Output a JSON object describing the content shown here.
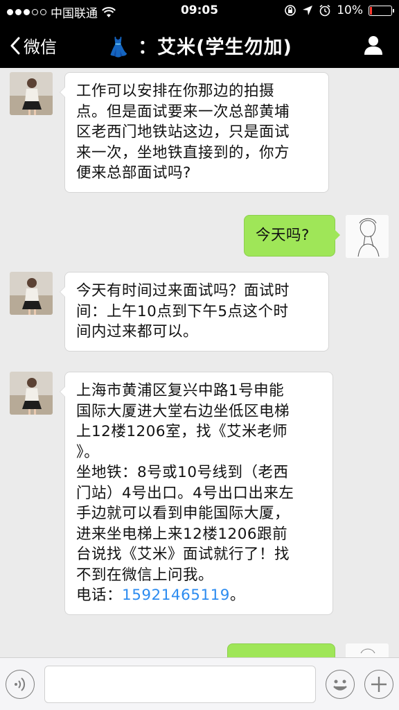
{
  "status_bar": {
    "carrier": "中国联通",
    "time": "09:05",
    "battery": "10%",
    "battery_level": 0.1
  },
  "nav": {
    "back_label": "微信",
    "title_emoji": "👗",
    "title_text": "：艾米(学生勿加)"
  },
  "messages": [
    {
      "from": "contact",
      "lines": [
        "工作可以安排在你那边的拍摄",
        "点。但是面试要来一次总部黄埔",
        "区老西门地铁站这边，只是面试",
        "来一次，坐地铁直接到的，你方",
        "便来总部面试吗?"
      ]
    },
    {
      "from": "me",
      "lines": [
        "今天吗?"
      ]
    },
    {
      "from": "contact",
      "lines": [
        "今天有时间过来面试吗？面试时",
        "间：上午10点到下午5点这个时",
        "间内过来都可以。"
      ]
    },
    {
      "from": "contact",
      "lines": [
        "上海市黄浦区复兴中路1号申能",
        "国际大厦进大堂右边坐低区电梯",
        "上12楼1206室，找《艾米老师",
        "》。",
        "坐地铁：8号或10号线到（老西",
        "门站）4号出口。4号出口出来左",
        "手边就可以看到申能国际大厦，",
        "进来坐电梯上来12楼1206跟前",
        "台说找《艾米》面试就行了！找",
        "不到在微信上问我。"
      ],
      "phone_label": "电话：",
      "phone_number": "15921465119",
      "phone_suffix": "。"
    }
  ],
  "input_bar": {
    "text_value": ""
  }
}
